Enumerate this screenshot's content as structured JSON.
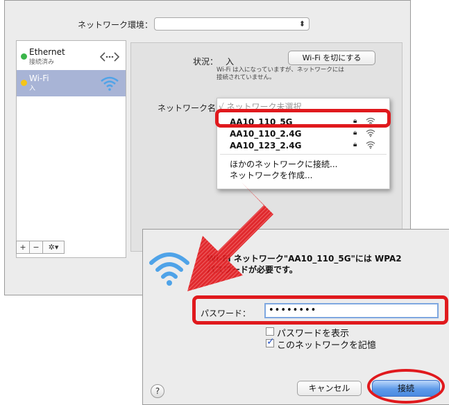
{
  "prefs": {
    "location_label": "ネットワーク環境：",
    "location_value": "",
    "services": [
      {
        "name": "Ethernet",
        "status": "接続済み",
        "dot_color": "#3bb54a",
        "icon": "ethernet-icon"
      },
      {
        "name": "Wi-Fi",
        "status": "入",
        "dot_color": "#f5c518",
        "icon": "wifi-icon"
      }
    ],
    "toolbar": {
      "add": "+",
      "remove": "−",
      "action": "✲▾"
    },
    "status_label": "状況：",
    "status_value": "入",
    "wifi_off_button": "Wi-Fi を切にする",
    "status_desc_1": "Wi-Fi は入になっていますが、ネットワークには",
    "status_desc_2": "接続されていません。",
    "network_name_label": "ネットワーク名：",
    "network_menu": {
      "none_selected": "√ ネットワーク未選択",
      "networks": [
        {
          "ssid": "AA10_110_5G",
          "secured": true
        },
        {
          "ssid": "AA10_110_2.4G",
          "secured": true
        },
        {
          "ssid": "AA10_123_2.4G",
          "secured": true
        }
      ],
      "join_other": "ほかのネットワークに接続...",
      "create": "ネットワークを作成..."
    }
  },
  "dialog": {
    "title_line1": "Wi-Fi ネットワーク\"AA10_110_5G\"には WPA2",
    "title_line2": "パスワードが必要です。",
    "password_label": "パスワード：",
    "password_value": "••••••••",
    "show_password_label": "パスワードを表示",
    "show_password_checked": false,
    "remember_label": "このネットワークを記憶",
    "remember_checked": true,
    "help": "?",
    "cancel_button": "キャンセル",
    "connect_button": "接続"
  },
  "colors": {
    "highlight": "#e0191d",
    "arrow": "#e0191d",
    "accent": "#4a8ae0"
  }
}
